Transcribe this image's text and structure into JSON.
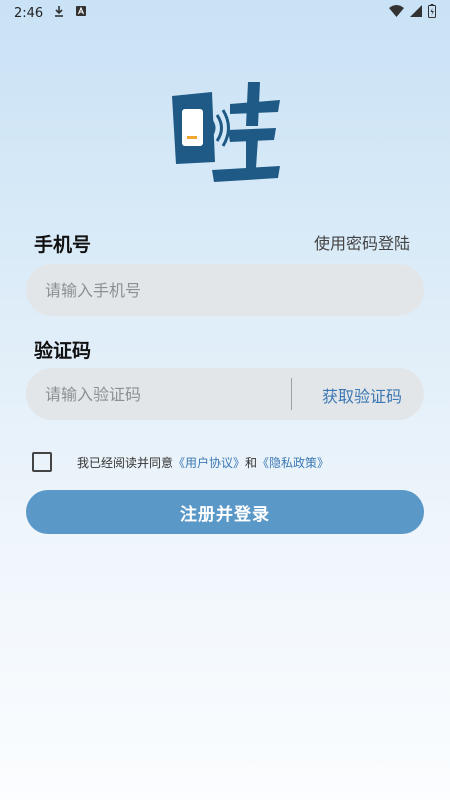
{
  "status": {
    "time": "2:46"
  },
  "colors": {
    "accent": "#3b78b3",
    "button": "#5a98c7",
    "logo": "#1f5a86",
    "logo_accent": "#f0a832"
  },
  "icons": {
    "status_left": [
      "download-icon",
      "notification-a-icon"
    ],
    "status_right": [
      "wifi-icon",
      "signal-icon",
      "battery-icon"
    ],
    "logo": "app-logo"
  },
  "login": {
    "phone_label": "手机号",
    "password_login_link": "使用密码登陆",
    "phone_placeholder": "请输入手机号",
    "code_label": "验证码",
    "code_placeholder": "请输入验证码",
    "get_code_button": "获取验证码",
    "agreement": {
      "prefix": "我已经阅读并同意",
      "user_agreement": "《用户协议》",
      "and": "和",
      "privacy_policy": "《隐私政策》",
      "checked": false
    },
    "submit_button": "注册并登录"
  }
}
